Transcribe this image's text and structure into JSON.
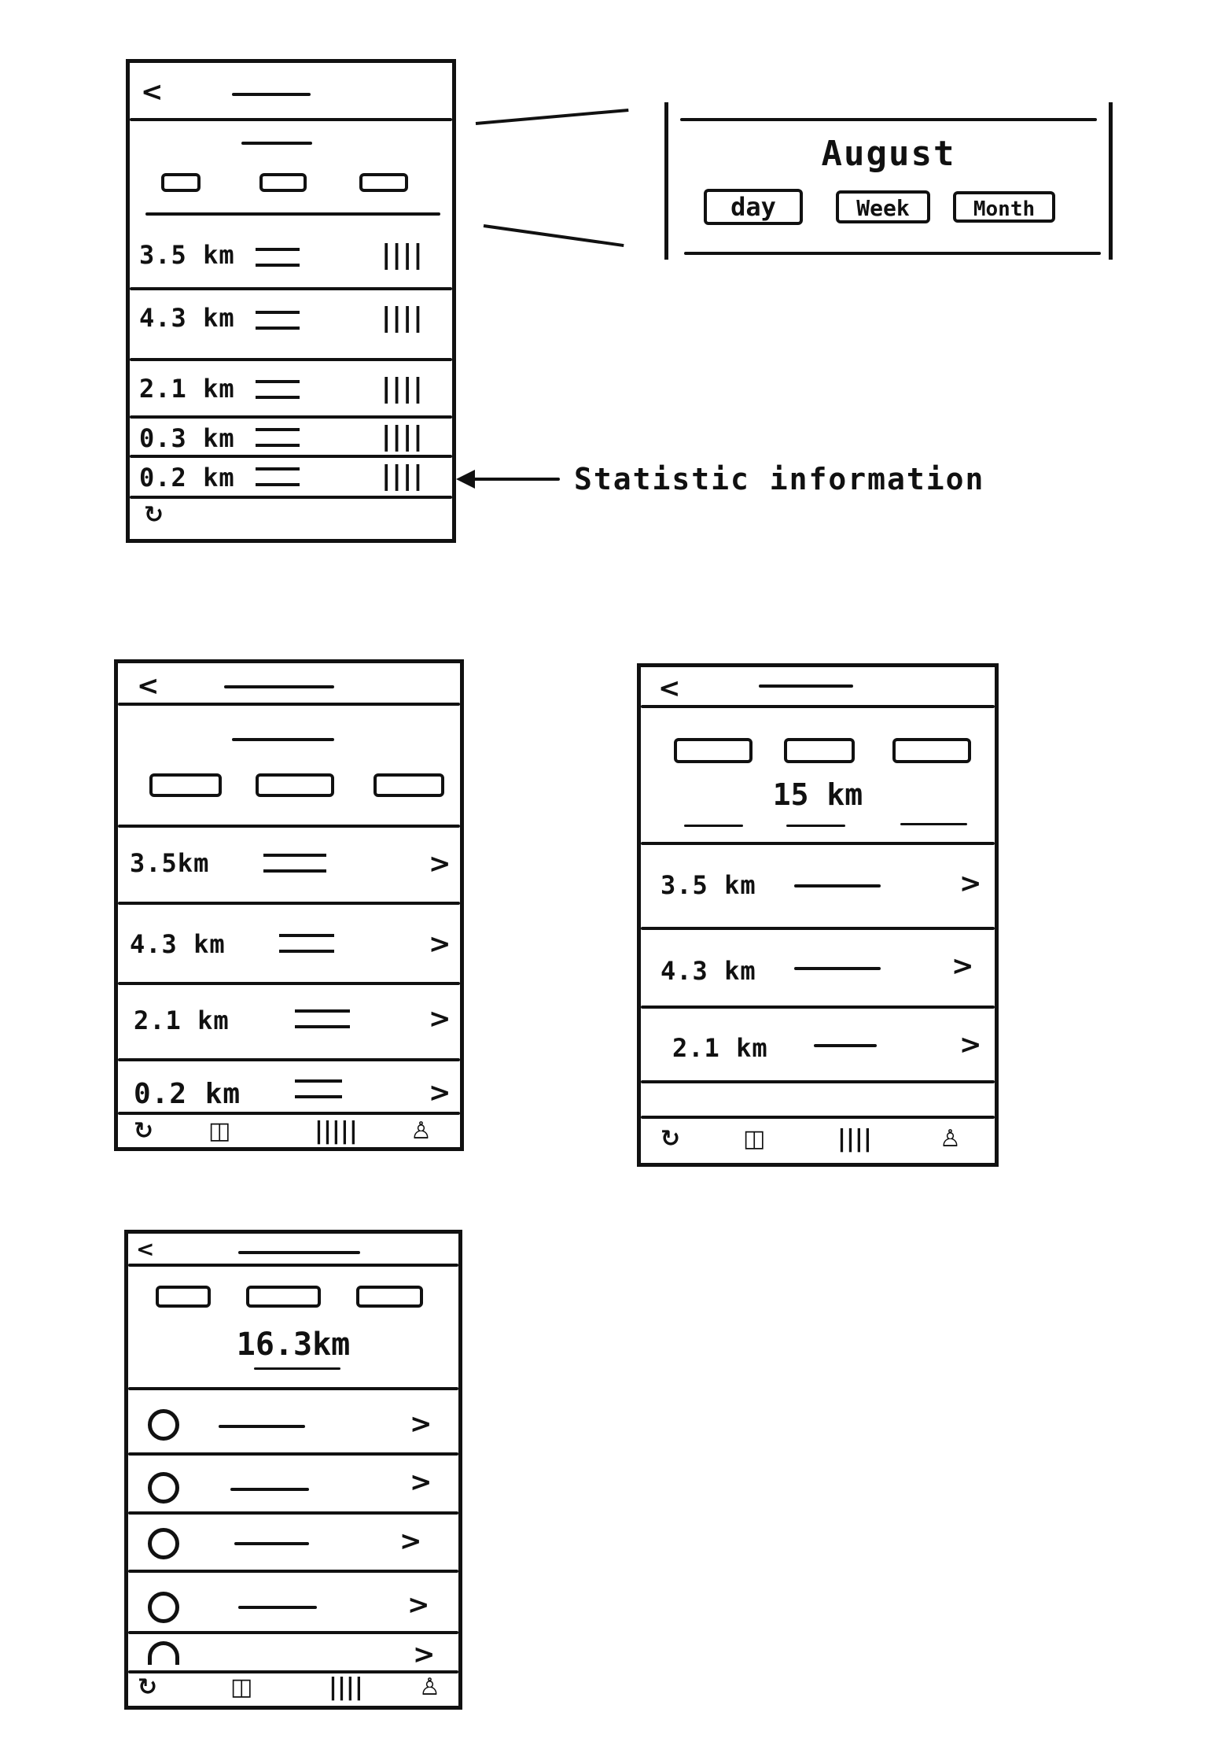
{
  "annotations": {
    "month_label": "August",
    "segments": [
      "day",
      "Week",
      "Month"
    ],
    "arrow_label": "Statistic information"
  },
  "screen1": {
    "rows": [
      {
        "distance": "3.5 km"
      },
      {
        "distance": "4.3 km"
      },
      {
        "distance": "2.1 km"
      },
      {
        "distance": "0.3 km"
      },
      {
        "distance": "0.2 km"
      }
    ]
  },
  "screen2": {
    "rows": [
      {
        "distance": "3.5km"
      },
      {
        "distance": "4.3 km"
      },
      {
        "distance": "2.1 km"
      },
      {
        "distance": "0.2 km"
      }
    ],
    "nav_icons": [
      "running-icon",
      "map-icon",
      "stats-icon",
      "profile-icon"
    ]
  },
  "screen3": {
    "total": "15 km",
    "rows": [
      {
        "distance": "3.5 km"
      },
      {
        "distance": "4.3 km"
      },
      {
        "distance": "2.1 km"
      }
    ]
  },
  "screen4": {
    "total": "16.3km",
    "rows": 5
  },
  "icons": {
    "back": "back-chevron-icon",
    "chevron": "chevron-right-icon",
    "stats": "stats-bars-icon"
  }
}
